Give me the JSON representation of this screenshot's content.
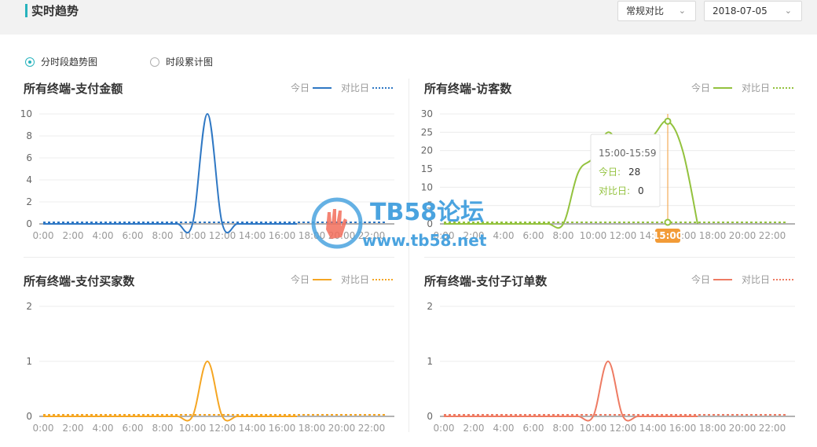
{
  "header": {
    "title": "实时趋势",
    "compare_mode": "常规对比",
    "date": "2018-07-05"
  },
  "view_toggle": {
    "options": [
      {
        "label": "分时段趋势图",
        "checked": true
      },
      {
        "label": "时段累计图",
        "checked": false
      }
    ]
  },
  "legend": {
    "today": "今日",
    "compare": "对比日"
  },
  "watermark": {
    "brand": "TB58论坛",
    "url": "www.tb58.net"
  },
  "tooltip": {
    "range": "15:00-15:59",
    "today_label": "今日:",
    "today_value": "28",
    "compare_label": "对比日:",
    "compare_value": "0",
    "axis_marker": "15:00"
  },
  "chart_data": [
    {
      "type": "line",
      "title": "所有终端-支付金额",
      "color": "#2f78c4",
      "x": [
        "0:00",
        "1:00",
        "2:00",
        "3:00",
        "4:00",
        "5:00",
        "6:00",
        "7:00",
        "8:00",
        "9:00",
        "10:00",
        "11:00",
        "12:00",
        "13:00",
        "14:00",
        "15:00",
        "16:00",
        "17:00",
        "18:00",
        "19:00",
        "20:00",
        "21:00",
        "22:00",
        "23:00"
      ],
      "xticks": [
        "0:00",
        "2:00",
        "4:00",
        "6:00",
        "8:00",
        "10:00",
        "12:00",
        "14:00",
        "16:00",
        "18:00",
        "20:00",
        "22:00"
      ],
      "yticks": [
        "0",
        "2",
        "4",
        "6",
        "8",
        "10"
      ],
      "ylim": [
        0,
        10
      ],
      "series": [
        {
          "name": "今日",
          "values": [
            0,
            0,
            0,
            0,
            0,
            0,
            0,
            0,
            0,
            0,
            0,
            10,
            0,
            0,
            0,
            0,
            0,
            0,
            null,
            null,
            null,
            null,
            null,
            null
          ]
        },
        {
          "name": "对比日",
          "values": [
            0,
            0,
            0,
            0,
            0,
            0,
            0,
            0,
            0,
            0,
            0,
            0,
            0,
            0,
            0,
            0,
            0,
            0,
            0,
            0,
            0,
            0,
            0,
            0
          ]
        }
      ]
    },
    {
      "type": "line",
      "title": "所有终端-访客数",
      "color": "#93c23e",
      "x": [
        "0:00",
        "1:00",
        "2:00",
        "3:00",
        "4:00",
        "5:00",
        "6:00",
        "7:00",
        "8:00",
        "9:00",
        "10:00",
        "11:00",
        "12:00",
        "13:00",
        "14:00",
        "15:00",
        "16:00",
        "17:00",
        "18:00",
        "19:00",
        "20:00",
        "21:00",
        "22:00",
        "23:00"
      ],
      "xticks": [
        "0:00",
        "2:00",
        "4:00",
        "6:00",
        "8:00",
        "10:00",
        "12:00",
        "14:00",
        "16:00",
        "18:00",
        "20:00",
        "22:00"
      ],
      "yticks": [
        "0",
        "5",
        "10",
        "15",
        "20",
        "25",
        "30"
      ],
      "ylim": [
        0,
        30
      ],
      "series": [
        {
          "name": "今日",
          "values": [
            0,
            0,
            0,
            0,
            0,
            0,
            0,
            0,
            0,
            14,
            18,
            25,
            20,
            22,
            24,
            28,
            20,
            0,
            null,
            null,
            null,
            null,
            null,
            null
          ]
        },
        {
          "name": "对比日",
          "values": [
            0,
            0,
            0,
            0,
            0,
            0,
            0,
            0,
            0,
            0,
            0,
            0,
            0,
            0,
            0,
            0,
            0,
            0,
            0,
            0,
            0,
            0,
            0,
            0
          ]
        }
      ]
    },
    {
      "type": "line",
      "title": "所有终端-支付买家数",
      "color": "#f5a623",
      "x": [
        "0:00",
        "1:00",
        "2:00",
        "3:00",
        "4:00",
        "5:00",
        "6:00",
        "7:00",
        "8:00",
        "9:00",
        "10:00",
        "11:00",
        "12:00",
        "13:00",
        "14:00",
        "15:00",
        "16:00",
        "17:00",
        "18:00",
        "19:00",
        "20:00",
        "21:00",
        "22:00",
        "23:00"
      ],
      "xticks": [
        "0:00",
        "2:00",
        "4:00",
        "6:00",
        "8:00",
        "10:00",
        "12:00",
        "14:00",
        "16:00",
        "18:00",
        "20:00",
        "22:00"
      ],
      "yticks": [
        "0",
        "1",
        "2"
      ],
      "ylim": [
        0,
        2
      ],
      "series": [
        {
          "name": "今日",
          "values": [
            0,
            0,
            0,
            0,
            0,
            0,
            0,
            0,
            0,
            0,
            0,
            1,
            0,
            0,
            0,
            0,
            0,
            0,
            null,
            null,
            null,
            null,
            null,
            null
          ]
        },
        {
          "name": "对比日",
          "values": [
            0,
            0,
            0,
            0,
            0,
            0,
            0,
            0,
            0,
            0,
            0,
            0,
            0,
            0,
            0,
            0,
            0,
            0,
            0,
            0,
            0,
            0,
            0,
            0
          ]
        }
      ]
    },
    {
      "type": "line",
      "title": "所有终端-支付子订单数",
      "color": "#ee7b63",
      "x": [
        "0:00",
        "1:00",
        "2:00",
        "3:00",
        "4:00",
        "5:00",
        "6:00",
        "7:00",
        "8:00",
        "9:00",
        "10:00",
        "11:00",
        "12:00",
        "13:00",
        "14:00",
        "15:00",
        "16:00",
        "17:00",
        "18:00",
        "19:00",
        "20:00",
        "21:00",
        "22:00",
        "23:00"
      ],
      "xticks": [
        "0:00",
        "2:00",
        "4:00",
        "6:00",
        "8:00",
        "10:00",
        "12:00",
        "14:00",
        "16:00",
        "18:00",
        "20:00",
        "22:00"
      ],
      "yticks": [
        "0",
        "1",
        "2"
      ],
      "ylim": [
        0,
        2
      ],
      "series": [
        {
          "name": "今日",
          "values": [
            0,
            0,
            0,
            0,
            0,
            0,
            0,
            0,
            0,
            0,
            0,
            1,
            0,
            0,
            0,
            0,
            0,
            0,
            null,
            null,
            null,
            null,
            null,
            null
          ]
        },
        {
          "name": "对比日",
          "values": [
            0,
            0,
            0,
            0,
            0,
            0,
            0,
            0,
            0,
            0,
            0,
            0,
            0,
            0,
            0,
            0,
            0,
            0,
            0,
            0,
            0,
            0,
            0,
            0
          ]
        }
      ]
    }
  ]
}
